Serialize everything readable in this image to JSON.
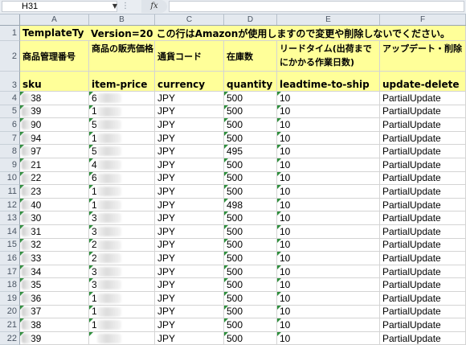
{
  "formula_bar": {
    "name_box": "H31",
    "fx_label": "fx",
    "formula": ""
  },
  "columns": [
    "A",
    "B",
    "C",
    "D",
    "E",
    "F"
  ],
  "row1": {
    "row_number": "1",
    "a": "TemplateTy",
    "b_to_f": "Version=20 この行はAmazonが使用しますので変更や削除しないでください。"
  },
  "row2": {
    "row_number": "2",
    "cells": [
      "商品管理番号",
      "商品の販売価格",
      "通貨コード",
      "在庫数",
      "リードタイム(出荷までにかかる作業日数)",
      "アップデート・削除"
    ]
  },
  "row3": {
    "row_number": "3",
    "cells": [
      "sku",
      "item-price",
      "currency",
      "quantity",
      "leadtime-to-ship",
      "update-delete"
    ]
  },
  "data_rows": [
    {
      "row": "4",
      "sku": "38",
      "price": "6",
      "currency": "JPY",
      "quantity": "500",
      "leadtime": "10",
      "update": "PartialUpdate"
    },
    {
      "row": "5",
      "sku": "39",
      "price": "1",
      "currency": "JPY",
      "quantity": "500",
      "leadtime": "10",
      "update": "PartialUpdate"
    },
    {
      "row": "6",
      "sku": "90",
      "price": "5",
      "currency": "JPY",
      "quantity": "500",
      "leadtime": "10",
      "update": "PartialUpdate"
    },
    {
      "row": "7",
      "sku": "94",
      "price": "1",
      "currency": "JPY",
      "quantity": "500",
      "leadtime": "10",
      "update": "PartialUpdate"
    },
    {
      "row": "8",
      "sku": "97",
      "price": "5",
      "currency": "JPY",
      "quantity": "495",
      "leadtime": "10",
      "update": "PartialUpdate"
    },
    {
      "row": "9",
      "sku": "21",
      "price": "4",
      "currency": "JPY",
      "quantity": "500",
      "leadtime": "10",
      "update": "PartialUpdate"
    },
    {
      "row": "10",
      "sku": "22",
      "price": "6",
      "currency": "JPY",
      "quantity": "500",
      "leadtime": "10",
      "update": "PartialUpdate"
    },
    {
      "row": "11",
      "sku": "23",
      "price": "1",
      "currency": "JPY",
      "quantity": "500",
      "leadtime": "10",
      "update": "PartialUpdate"
    },
    {
      "row": "12",
      "sku": "40",
      "price": "1",
      "currency": "JPY",
      "quantity": "498",
      "leadtime": "10",
      "update": "PartialUpdate"
    },
    {
      "row": "13",
      "sku": "30",
      "price": "3",
      "currency": "JPY",
      "quantity": "500",
      "leadtime": "10",
      "update": "PartialUpdate"
    },
    {
      "row": "14",
      "sku": "31",
      "price": "3",
      "currency": "JPY",
      "quantity": "500",
      "leadtime": "10",
      "update": "PartialUpdate"
    },
    {
      "row": "15",
      "sku": "32",
      "price": "2",
      "currency": "JPY",
      "quantity": "500",
      "leadtime": "10",
      "update": "PartialUpdate"
    },
    {
      "row": "16",
      "sku": "33",
      "price": "2",
      "currency": "JPY",
      "quantity": "500",
      "leadtime": "10",
      "update": "PartialUpdate"
    },
    {
      "row": "17",
      "sku": "34",
      "price": "3",
      "currency": "JPY",
      "quantity": "500",
      "leadtime": "10",
      "update": "PartialUpdate"
    },
    {
      "row": "18",
      "sku": "35",
      "price": "3",
      "currency": "JPY",
      "quantity": "500",
      "leadtime": "10",
      "update": "PartialUpdate"
    },
    {
      "row": "19",
      "sku": "36",
      "price": "1",
      "currency": "JPY",
      "quantity": "500",
      "leadtime": "10",
      "update": "PartialUpdate"
    },
    {
      "row": "20",
      "sku": "37",
      "price": "1",
      "currency": "JPY",
      "quantity": "500",
      "leadtime": "10",
      "update": "PartialUpdate"
    },
    {
      "row": "21",
      "sku": "38",
      "price": "1",
      "currency": "JPY",
      "quantity": "500",
      "leadtime": "10",
      "update": "PartialUpdate"
    },
    {
      "row": "22",
      "sku": "39",
      "price": "",
      "currency": "JPY",
      "quantity": "500",
      "leadtime": "10",
      "update": "PartialUpdate"
    }
  ],
  "colors": {
    "header_fill": "#ffff99",
    "error_triangle": "#2f8f3d",
    "sheet_chrome": "#e4e9ef"
  }
}
